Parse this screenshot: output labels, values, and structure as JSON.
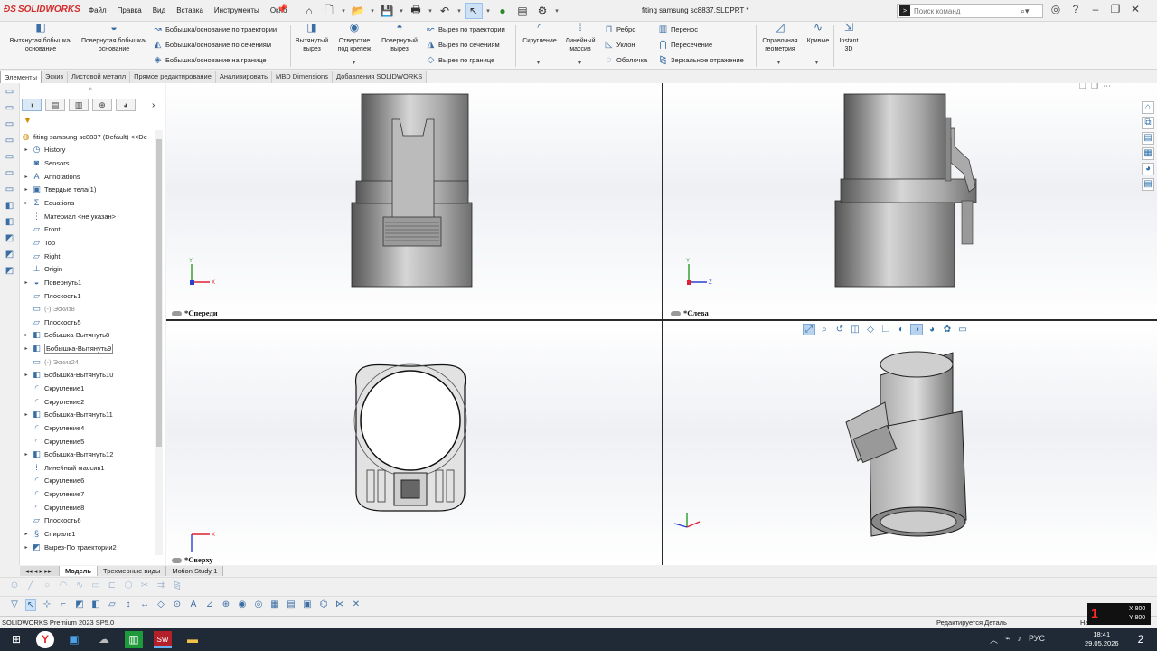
{
  "app": {
    "brand": "SOLIDWORKS",
    "doc_title": "fiting samsung sc8837.SLDPRT *",
    "menu": [
      "Файл",
      "Правка",
      "Вид",
      "Вставка",
      "Инструменты",
      "Окно"
    ],
    "search_placeholder": "Поиск команд"
  },
  "ribbon": {
    "extrude_boss": "Вытянутая бобышка/основание",
    "revolve_boss": "Повернутая бобышка/основание",
    "sweep_boss": "Бобышка/основание по траектории",
    "loft_boss": "Бобышка/основание по сечениям",
    "boundary_boss": "Бобышка/основание на границе",
    "extrude_cut": "Вытянутый вырез",
    "hole_wizard": "Отверстие под крепеж",
    "revolve_cut": "Повернутый вырез",
    "sweep_cut": "Вырез по траектории",
    "loft_cut": "Вырез по сечениям",
    "boundary_cut": "Вырез по границе",
    "fillet": "Скругление",
    "linear_pattern": "Линейный массив",
    "rib": "Ребро",
    "draft": "Уклон",
    "shell": "Оболочка",
    "wrap": "Перенос",
    "intersect": "Пересечение",
    "mirror": "Зеркальное отражение",
    "ref_geometry": "Справочная геометрия",
    "curves": "Кривые",
    "instant3d": "Instant 3D"
  },
  "tabs": [
    "Элементы",
    "Эскиз",
    "Листовой металл",
    "Прямое редактирование",
    "Анализировать",
    "MBD Dimensions",
    "Добавления SOLIDWORKS"
  ],
  "tree": {
    "root": "fiting samsung sc8837 (Default) <<De",
    "items": [
      {
        "label": "History",
        "exp": "▸",
        "icon": "history-icon",
        "glyph": "◷",
        "grey": false,
        "boxed": false
      },
      {
        "label": "Sensors",
        "exp": "",
        "icon": "sensor-icon",
        "glyph": "◙",
        "grey": false,
        "boxed": false
      },
      {
        "label": "Annotations",
        "exp": "▸",
        "icon": "annotation-icon",
        "glyph": "A",
        "grey": false,
        "boxed": false
      },
      {
        "label": "Твердые тела(1)",
        "exp": "▸",
        "icon": "solid-bodies-icon",
        "glyph": "▣",
        "grey": false,
        "boxed": false
      },
      {
        "label": "Equations",
        "exp": "▸",
        "icon": "equations-icon",
        "glyph": "Σ",
        "grey": false,
        "boxed": false
      },
      {
        "label": "Материал <не указан>",
        "exp": "",
        "icon": "material-icon",
        "glyph": "⋮",
        "grey": false,
        "boxed": false
      },
      {
        "label": "Front",
        "exp": "",
        "icon": "plane-icon",
        "glyph": "▱",
        "grey": false,
        "boxed": false
      },
      {
        "label": "Top",
        "exp": "",
        "icon": "plane-icon",
        "glyph": "▱",
        "grey": false,
        "boxed": false
      },
      {
        "label": "Right",
        "exp": "",
        "icon": "plane-icon",
        "glyph": "▱",
        "grey": false,
        "boxed": false
      },
      {
        "label": "Origin",
        "exp": "",
        "icon": "origin-icon",
        "glyph": "⊥",
        "grey": false,
        "boxed": false
      },
      {
        "label": "Повернуть1",
        "exp": "▸",
        "icon": "revolve-icon",
        "glyph": "◒",
        "grey": false,
        "boxed": false
      },
      {
        "label": "Плоскость1",
        "exp": "",
        "icon": "plane-icon",
        "glyph": "▱",
        "grey": false,
        "boxed": false
      },
      {
        "label": "(-) Эскиз8",
        "exp": "",
        "icon": "sketch-icon",
        "glyph": "▭",
        "grey": true,
        "boxed": false
      },
      {
        "label": "Плоскость5",
        "exp": "",
        "icon": "plane-icon",
        "glyph": "▱",
        "grey": false,
        "boxed": false
      },
      {
        "label": "Бобышка-Вытянуть8",
        "exp": "▸",
        "icon": "extrude-icon",
        "glyph": "◧",
        "grey": false,
        "boxed": false
      },
      {
        "label": "Бобышка-Вытянуть9",
        "exp": "▸",
        "icon": "extrude-icon",
        "glyph": "◧",
        "grey": false,
        "boxed": true
      },
      {
        "label": "(-) Эскиз24",
        "exp": "",
        "icon": "sketch-icon",
        "glyph": "▭",
        "grey": true,
        "boxed": false
      },
      {
        "label": "Бобышка-Вытянуть10",
        "exp": "▸",
        "icon": "extrude-icon",
        "glyph": "◧",
        "grey": false,
        "boxed": false
      },
      {
        "label": "Скругление1",
        "exp": "",
        "icon": "fillet-icon",
        "glyph": "◜",
        "grey": false,
        "boxed": false
      },
      {
        "label": "Скругление2",
        "exp": "",
        "icon": "fillet-icon",
        "glyph": "◜",
        "grey": false,
        "boxed": false
      },
      {
        "label": "Бобышка-Вытянуть11",
        "exp": "▸",
        "icon": "extrude-icon",
        "glyph": "◧",
        "grey": false,
        "boxed": false
      },
      {
        "label": "Скругление4",
        "exp": "",
        "icon": "fillet-icon",
        "glyph": "◜",
        "grey": false,
        "boxed": false
      },
      {
        "label": "Скругление5",
        "exp": "",
        "icon": "fillet-icon",
        "glyph": "◜",
        "grey": false,
        "boxed": false
      },
      {
        "label": "Бобышка-Вытянуть12",
        "exp": "▸",
        "icon": "extrude-icon",
        "glyph": "◧",
        "grey": false,
        "boxed": false
      },
      {
        "label": "Линейный массив1",
        "exp": "",
        "icon": "linear-pattern-icon",
        "glyph": "⁞",
        "grey": false,
        "boxed": false
      },
      {
        "label": "Скругление6",
        "exp": "",
        "icon": "fillet-icon",
        "glyph": "◜",
        "grey": false,
        "boxed": false
      },
      {
        "label": "Скругление7",
        "exp": "",
        "icon": "fillet-icon",
        "glyph": "◜",
        "grey": false,
        "boxed": false
      },
      {
        "label": "Скругление8",
        "exp": "",
        "icon": "fillet-icon",
        "glyph": "◜",
        "grey": false,
        "boxed": false
      },
      {
        "label": "Плоскость6",
        "exp": "",
        "icon": "plane-icon",
        "glyph": "▱",
        "grey": false,
        "boxed": false
      },
      {
        "label": "Спираль1",
        "exp": "▸",
        "icon": "helix-icon",
        "glyph": "§",
        "grey": false,
        "boxed": false
      },
      {
        "label": "Вырез-По траектории2",
        "exp": "▸",
        "icon": "sweep-cut-icon",
        "glyph": "◩",
        "grey": false,
        "boxed": false
      }
    ]
  },
  "viewports": {
    "front": "*Спереди",
    "left": "*Слева",
    "top": "*Сверху"
  },
  "bottom_tabs": [
    "Модель",
    "Трехмерные виды",
    "Motion Study 1"
  ],
  "status": {
    "product": "SOLIDWORKS Premium 2023 SP5.0",
    "mode": "Редактируется Деталь",
    "right": "На",
    "coord_x": "X 800",
    "coord_y": "Y 800",
    "coord_badge": "1"
  },
  "taskbar": {
    "lang": "РУС",
    "time": "18:41",
    "date": "29.05.2026",
    "notif_count": "2"
  }
}
